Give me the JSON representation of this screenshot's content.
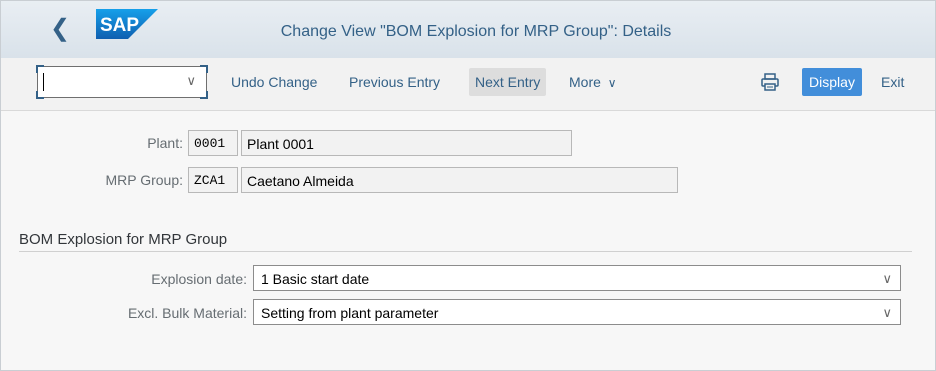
{
  "header": {
    "title": "Change View \"BOM Explosion for MRP Group\": Details",
    "logo_text": "SAP",
    "brand_color": "#1a73c9"
  },
  "toolbar": {
    "command_field": {
      "value": "",
      "placeholder": ""
    },
    "undo_change": "Undo Change",
    "previous_entry": "Previous Entry",
    "next_entry": "Next Entry",
    "more": "More",
    "display": "Display",
    "exit": "Exit"
  },
  "fields": {
    "plant": {
      "label": "Plant:",
      "code": "0001",
      "description": "Plant 0001"
    },
    "mrp_group": {
      "label": "MRP Group:",
      "code": "ZCA1",
      "description": "Caetano Almeida"
    }
  },
  "section": {
    "title": "BOM Explosion for MRP Group",
    "explosion_date": {
      "label": "Explosion date:",
      "value": "1 Basic start date"
    },
    "excl_bulk_material": {
      "label": "Excl. Bulk Material:",
      "value": "Setting from plant parameter"
    }
  },
  "icons": {
    "back": "back-chevron-icon",
    "print": "printer-icon",
    "dropdown": "chevron-down-icon"
  }
}
